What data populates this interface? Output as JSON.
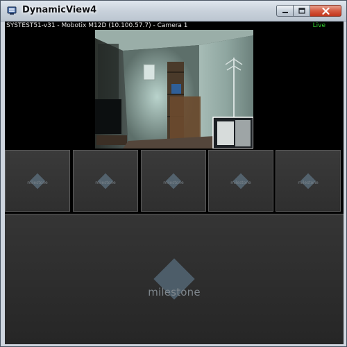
{
  "window": {
    "title": "DynamicView4",
    "buttons": {
      "minimize": "minimize",
      "maximize": "maximize",
      "close": "close"
    }
  },
  "camera": {
    "title": "SYSTEST51-v31 - Mobotix M12D (10.100.57.7) - Camera 1",
    "status": "Live",
    "status_color": "#35d633"
  },
  "empty_tiles": [
    {
      "logo": "milestone-logo-icon"
    },
    {
      "logo": "milestone-logo-icon"
    },
    {
      "logo": "milestone-logo-icon"
    },
    {
      "logo": "milestone-logo-icon"
    },
    {
      "logo": "milestone-logo-icon"
    }
  ],
  "brand": {
    "name": "milestone"
  }
}
